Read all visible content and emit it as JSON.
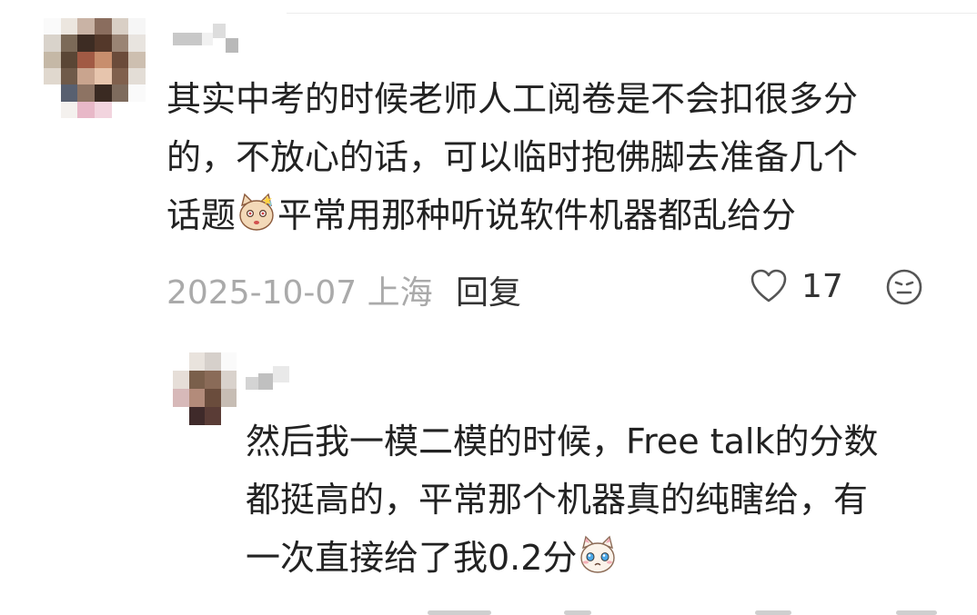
{
  "comment": {
    "lines": [
      "其实中考的时候老师人工阅卷是不会扣很多分",
      "的，不放心的话，可以临时抱佛脚去准备几个",
      [
        "话题",
        "平常用那种听说软件机器都乱给分"
      ]
    ],
    "emoji": "sweating-cat-emoji",
    "date_location": "2025-10-07 上海",
    "reply_label": "回复",
    "like_count": "17"
  },
  "reply": {
    "lines": [
      "然后我一模二模的时候，Free talk的分数",
      "都挺高的，平常那个机器真的纯瞎给，有",
      "一次直接给了我0.2分"
    ],
    "emoji": "crying-cat-emoji"
  },
  "colors": {
    "text": "#222222",
    "meta_gray": "#aaaaaa",
    "icon_gray": "#555555"
  }
}
